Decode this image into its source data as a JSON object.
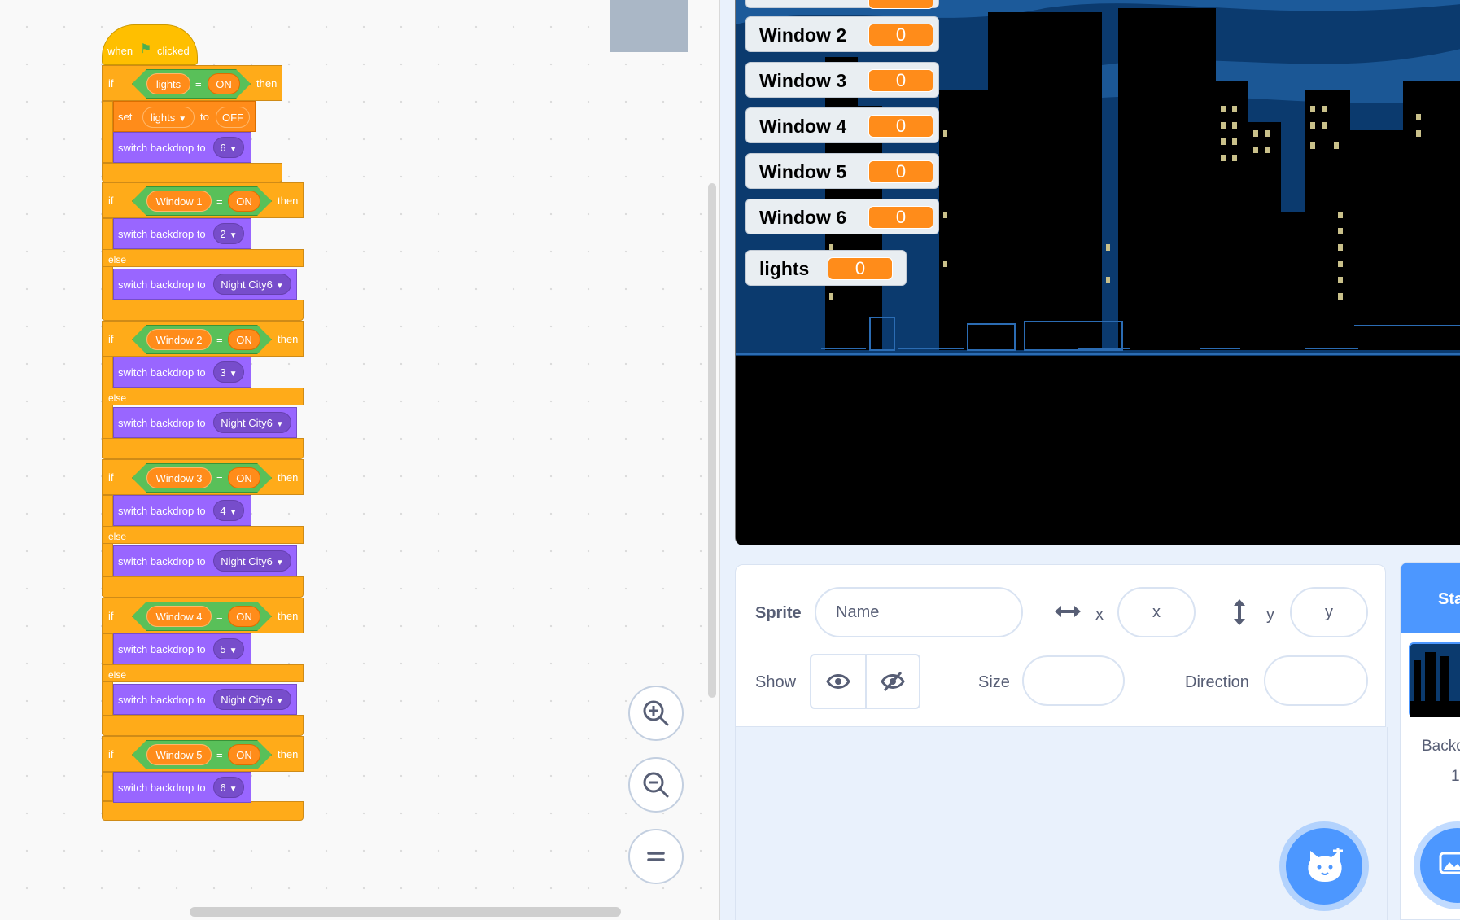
{
  "script": {
    "hat": {
      "when": "when",
      "clicked": "clicked"
    },
    "if_label": "if",
    "then_label": "then",
    "else_label": "else",
    "eq": "=",
    "set_block": {
      "set": "set",
      "variable": "lights",
      "to": "to",
      "value": "OFF"
    },
    "switch_label": "switch backdrop to",
    "cond_lights": {
      "variable": "lights",
      "value": "ON"
    },
    "backdrop_6": "6",
    "windows": [
      {
        "variable": "Window 1",
        "value": "ON",
        "then_backdrop": "2",
        "else_backdrop": "Night City6"
      },
      {
        "variable": "Window 2",
        "value": "ON",
        "then_backdrop": "3",
        "else_backdrop": "Night City6"
      },
      {
        "variable": "Window 3",
        "value": "ON",
        "then_backdrop": "4",
        "else_backdrop": "Night City6"
      },
      {
        "variable": "Window 4",
        "value": "ON",
        "then_backdrop": "5",
        "else_backdrop": "Night City6"
      },
      {
        "variable": "Window 5",
        "value": "ON",
        "then_backdrop": "6"
      }
    ]
  },
  "monitors": [
    {
      "label": "Window 2",
      "value": "0"
    },
    {
      "label": "Window 3",
      "value": "0"
    },
    {
      "label": "Window 4",
      "value": "0"
    },
    {
      "label": "Window 5",
      "value": "0"
    },
    {
      "label": "Window 6",
      "value": "0"
    },
    {
      "label": "lights",
      "value": "0"
    }
  ],
  "sprite_info": {
    "sprite_label": "Sprite",
    "name_placeholder": "Name",
    "x_label": "x",
    "x_placeholder": "x",
    "y_label": "y",
    "y_placeholder": "y",
    "show_label": "Show",
    "size_label": "Size",
    "direction_label": "Direction"
  },
  "stage_panel": {
    "header": "Sta",
    "backdrops_label": "Backd",
    "backdrop_count": "1"
  },
  "colors": {
    "events": "#ffbf00",
    "control": "#ffab19",
    "looks": "#9966ff",
    "variables": "#ff8c1a",
    "operators": "#59c059",
    "accent": "#4c97ff"
  }
}
